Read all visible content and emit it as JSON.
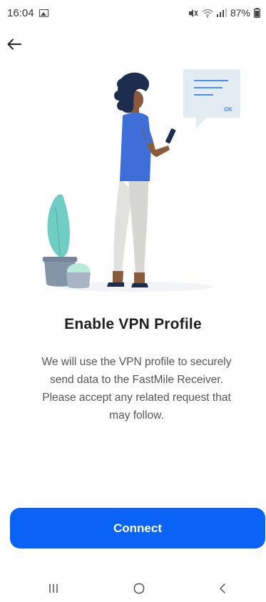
{
  "status_bar": {
    "time": "16:04",
    "battery": "87%",
    "icons": [
      "gallery-icon",
      "mute-icon",
      "wifi-icon",
      "signal-icon",
      "battery-icon"
    ]
  },
  "header": {
    "back_icon": "arrow-left-icon"
  },
  "illustration": {
    "popup_label": "OK",
    "colors": {
      "shirt": "#3e6ed8",
      "pants": "#e1e1df",
      "hair": "#1d2d4e",
      "skin": "#8a5a3c",
      "plant": "#6fcdc3",
      "pot": "#8595a8",
      "card_bg": "#e4ecf3",
      "card_lines": "#4a8ef0"
    }
  },
  "content": {
    "title": "Enable VPN Profile",
    "description": "We will use the VPN profile to securely send data to the FastMile Receiver. Please accept any related request that may follow."
  },
  "actions": {
    "connect_label": "Connect"
  },
  "nav_bar": {
    "icons": [
      "recent-apps-icon",
      "home-icon",
      "back-icon"
    ]
  },
  "colors": {
    "accent": "#0a63f5"
  }
}
